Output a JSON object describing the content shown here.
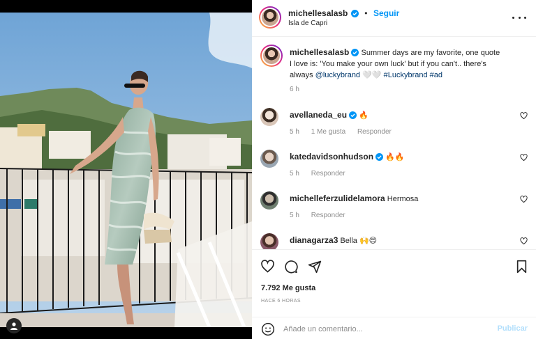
{
  "colors": {
    "accent": "#0095f6",
    "link": "#00376b",
    "muted": "#8e8e8e",
    "text": "#262626"
  },
  "post": {
    "username": "michellesalasb",
    "follow_label": "Seguir",
    "location": "Isla de Capri",
    "more_icon": "more-horizontal-icon",
    "photo_alt": "Mujer con vestido teñido verde sentada en un balcón en Capri"
  },
  "caption": {
    "username": "michellesalasb",
    "text": "Summer days are my favorite, one quote I love is: 'You make your own luck' but if you can't.. there's always",
    "mention": "@luckybrand",
    "emoji": "🤍🤍",
    "hashtag1": "#Luckybrand",
    "hashtag2": "#ad",
    "time": "6 h"
  },
  "comments": [
    {
      "username": "avellaneda_eu",
      "verified": true,
      "text": "🔥",
      "time": "5 h",
      "likes": "1 Me gusta",
      "reply": "Responder",
      "avatar_color": "#d9c6b8"
    },
    {
      "username": "katedavidsonhudson",
      "verified": true,
      "text": "🔥🔥",
      "time": "5 h",
      "likes": "",
      "reply": "Responder",
      "avatar_color": "#9aa7b3"
    },
    {
      "username": "michelleferzulidelamora",
      "verified": false,
      "text": "Hermosa",
      "time": "5 h",
      "likes": "",
      "reply": "Responder",
      "avatar_color": "#6f7f70"
    },
    {
      "username": "dianagarza3",
      "verified": false,
      "text": "Bella 🙌😍",
      "time": "",
      "likes": "",
      "reply": "",
      "avatar_color": "#8a5a6a"
    }
  ],
  "actions": {
    "like_icon": "heart-icon",
    "comment_icon": "comment-icon",
    "share_icon": "send-icon",
    "save_icon": "bookmark-icon",
    "likes_count": "7.792 Me gusta",
    "time_ago": "HACE 6 HORAS"
  },
  "add_comment": {
    "placeholder": "Añade un comentario...",
    "publish_label": "Publicar",
    "emoji_icon": "smiley-icon"
  }
}
